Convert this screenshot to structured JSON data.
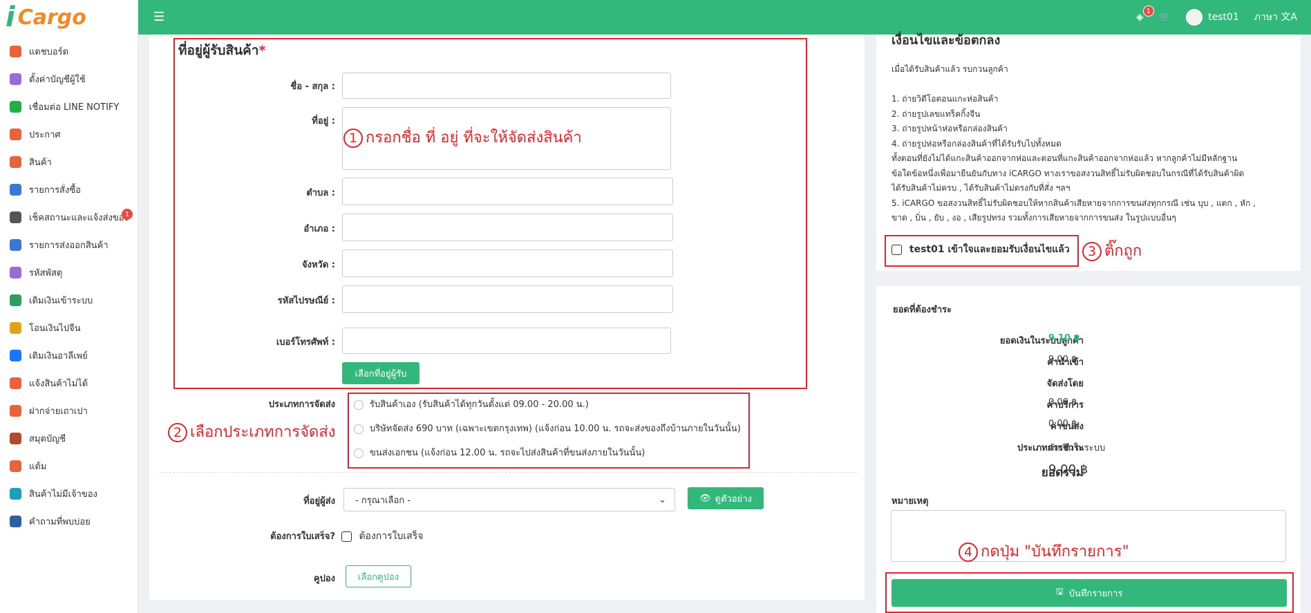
{
  "app": {
    "logo_i": "i",
    "logo_name": "Cargo"
  },
  "sidebar": {
    "items": [
      {
        "label": "แดชบอร์ด",
        "color": "#e8633a"
      },
      {
        "label": "ตั้งค่าบัญชีผู้ใช้",
        "color": "#9b6ad8"
      },
      {
        "label": "เชื่อมต่อ LINE NOTIFY",
        "color": "#1fb141"
      },
      {
        "label": "ประกาศ",
        "color": "#e8633a"
      },
      {
        "label": "สินค้า",
        "color": "#e8633a"
      },
      {
        "label": "รายการสั่งซื้อ",
        "color": "#3a78d6"
      },
      {
        "label": "เช็คสถานะและแจ้งส่งของ",
        "color": "#555555",
        "badge": "1"
      },
      {
        "label": "รายการส่งออกสินค้า",
        "color": "#3a78d6"
      },
      {
        "label": "รหัสพัสดุ",
        "color": "#9b6ad8"
      },
      {
        "label": "เติมเงินเข้าระบบ",
        "color": "#2f9e5b"
      },
      {
        "label": "โอนเงินไปจีน",
        "color": "#e0a216"
      },
      {
        "label": "เติมเงินอาลีเพย์",
        "color": "#1677ff"
      },
      {
        "label": "แจ้งสินค้าไม่ได้",
        "color": "#e8633a"
      },
      {
        "label": "ฝากจ่ายเถาเปา",
        "color": "#e8633a"
      },
      {
        "label": "สมุดบัญชี",
        "color": "#b5472b"
      },
      {
        "label": "แต้ม",
        "color": "#e8633a"
      },
      {
        "label": "สินค้าไม่มีเจ้าของ",
        "color": "#18a3b8"
      },
      {
        "label": "คำถามที่พบบ่อย",
        "color": "#2f5f9e"
      }
    ]
  },
  "topbar": {
    "notif_count": "1",
    "username": "test01",
    "language": "ภาษา",
    "toggle_icon": "☰",
    "lang_icon": "文A"
  },
  "address_form": {
    "title": "ที่อยู่ผู้รับสินค้า",
    "required": "*",
    "name_label": "ชื่อ - สกุล :",
    "address_label": "ที่อยู่ :",
    "subdistrict_label": "ตำบล :",
    "district_label": "อำเภอ :",
    "province_label": "จังหวัด :",
    "postcode_label": "รหัสไปรษณีย์ :",
    "phone_label": "เบอร์โทรศัพท์ :",
    "select_address_button": "เลือกที่อยู่ผู้รับ"
  },
  "shipping": {
    "label": "ประเภทการจัดส่ง",
    "options": [
      "รับสินค้าเอง (รับสินค้าได้ทุกวันตั้งแต่ 09.00 - 20.00 น.)",
      "บริษัทจัดส่ง 690 บาท (เฉพาะเขตกรุงเทพ) (แจ้งก่อน 10.00 น. รถจะส่งของถึงบ้านภายในวันนั้น)",
      "ขนส่งเอกชน (แจ้งก่อน 12.00 น. รถจะไปส่งสินค้าที่ขนส่งภายในวันนั้น)"
    ]
  },
  "sender": {
    "label": "ที่อยู่ผู้ส่ง",
    "placeholder": "- กรุณาเลือก -",
    "preview_button": "ดูตัวอย่าง"
  },
  "receipt": {
    "label": "ต้องการใบเสร็จ?",
    "checkbox_label": "ต้องการใบเสร็จ"
  },
  "coupon": {
    "label": "คูปอง",
    "button": "เลือกคูปอง"
  },
  "terms": {
    "title": "เงื่อนไขและข้อตกลง",
    "intro": "เมื่อได้รับสินค้าแล้ว รบกวนลูกค้า",
    "lines": [
      "1. ถ่ายวิดีโอตอนแกะห่อสินค้า",
      "2. ถ่ายรูปเลขแทร็คกิ้งจีน",
      "3. ถ่ายรูปหน้าห่อหรือกล่องสินค้า",
      "4. ถ่ายรูปห่อหรือกล่องสินค้าที่ได้รับรับไปทั้งหมด",
      "ทั้งตอนที่ยังไม่ได้แกะสินค้าออกจากห่อและตอนที่แกะสินค้าออกจากห่อแล้ว หากลูกค้าไม่มีหลักฐาน",
      "ข้อใดข้อหนึ่งเพื่อมายืนยันกับทาง iCARGO ทางเราขอสงวนสิทธิ์ไม่รับผิดชอบในกรณีที่ได้รับสินค้าผิด",
      " ได้รับสินค้าไม่ครบ , ได้รับสินค้าไม่ตรงกับที่สั่ง ฯลฯ",
      "5. iCARGO ขอสงวนสิทธิ์ไม่รับผิดชอบให้หากสินค้าเสียหายจากการขนส่งทุกกรณี เช่น บุบ , แตก , หัก ,",
      "ขาด , บิ่น , ยับ , งอ , เสียรูปทรง รวมทั้งการเสียหายจากการขนส่ง ในรูปแบบอื่นๆ"
    ],
    "accept_label": "test01 เข้าใจและยอมรับเงื่อนไขแล้ว"
  },
  "payment": {
    "title": "ยอดที่ต้องชำระ",
    "rows": [
      {
        "label": "ยอดเงินในระบบลูกค้า",
        "value": "9.10 ฿"
      },
      {
        "label": "ค่านำเข้า",
        "value": "9.00 ฿"
      },
      {
        "label": "จัดส่งโดย",
        "value": "-"
      },
      {
        "label": "ค่าบริการ",
        "value": "0.00 ฿"
      },
      {
        "label": "ค่าขนส่ง",
        "value": "0.00 ฿"
      },
      {
        "label": "ประเภทการชำระ",
        "value": "ตัดเงินในระบบ"
      }
    ],
    "total_label": "ยอดรวม",
    "total_value": "9.00 ฿",
    "note_label": "หมายเหตุ",
    "save_button": "บันทึกรายการ"
  },
  "annotations": {
    "step1": "1",
    "step1_text": "กรอกชื่อ ที่ อยู่ ที่จะให้จัดส่งสินค้า",
    "step2": "2",
    "step2_text": "เลือกประเภทการจัดส่ง",
    "step3": "3",
    "step3_text": "ติ๊กถูก",
    "step4": "4",
    "step4_text": "กดปุ่ม \"บันทึกรายการ\""
  }
}
